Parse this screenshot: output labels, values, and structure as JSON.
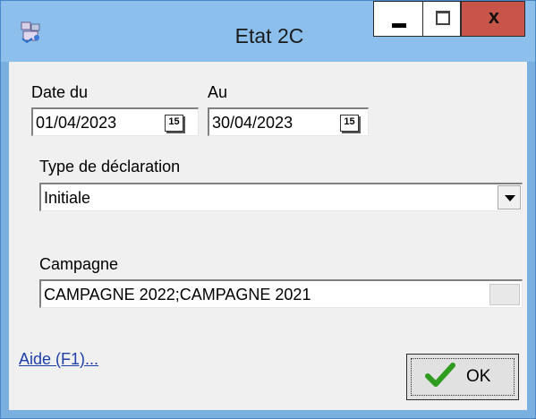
{
  "window": {
    "title": "Etat 2C",
    "icon": "app-icon",
    "controls": {
      "minimize_icon": "minimize-icon",
      "maximize_icon": "maximize-icon",
      "close_label": "x"
    }
  },
  "form": {
    "date_from_label": "Date du",
    "date_from_value": "01/04/2023",
    "date_to_label": "Au",
    "date_to_value": "30/04/2023",
    "calendar_icon_text": "15",
    "type_label": "Type de déclaration",
    "type_value": "Initiale",
    "campaign_label": "Campagne",
    "campaign_value": "CAMPAGNE 2022;CAMPAGNE 2021"
  },
  "footer": {
    "help_link": "Aide (F1)...",
    "ok_label": "OK"
  },
  "colors": {
    "title_bar": "#8cbfec",
    "close_button": "#c9544a",
    "dialog_body": "#f0f0f0",
    "link": "#1c3fa8",
    "ok_check": "#2e9c1e"
  }
}
